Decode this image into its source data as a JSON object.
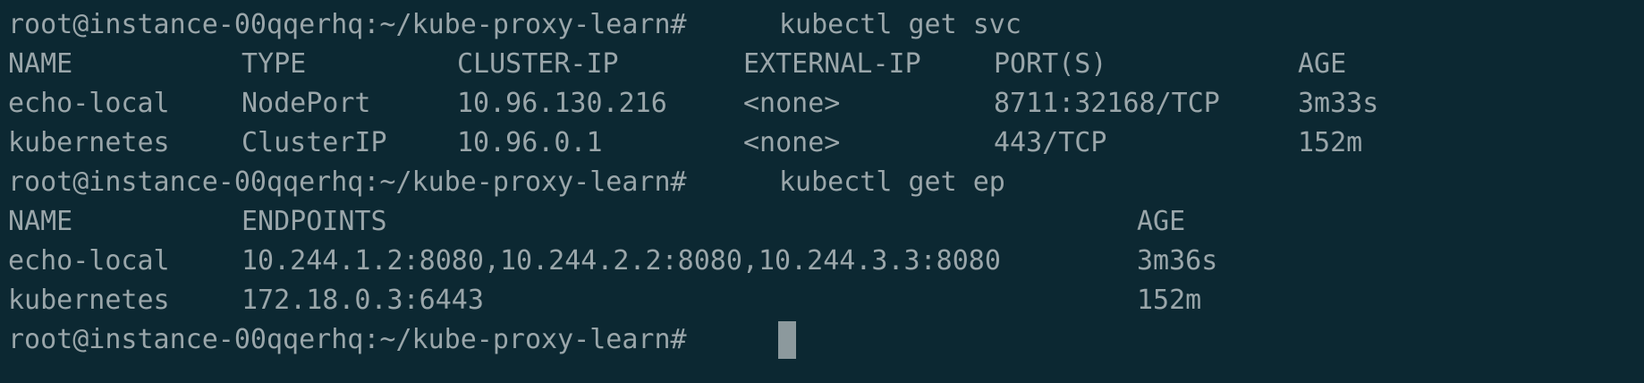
{
  "terminal": {
    "cmd1": {
      "prompt": "root@instance-00qqerhq:~/kube-proxy-learn#",
      "command": "kubectl get svc"
    },
    "svc": {
      "headers": [
        "NAME",
        "TYPE",
        "CLUSTER-IP",
        "EXTERNAL-IP",
        "PORT(S)",
        "AGE"
      ],
      "rows": [
        [
          "echo-local",
          "NodePort",
          "10.96.130.216",
          "<none>",
          "8711:32168/TCP",
          "3m33s"
        ],
        [
          "kubernetes",
          "ClusterIP",
          "10.96.0.1",
          "<none>",
          "443/TCP",
          "152m"
        ]
      ]
    },
    "cmd2": {
      "prompt": "root@instance-00qqerhq:~/kube-proxy-learn#",
      "command": "kubectl get ep"
    },
    "ep": {
      "headers": [
        "NAME",
        "ENDPOINTS",
        "AGE"
      ],
      "rows": [
        [
          "echo-local",
          "10.244.1.2:8080,10.244.2.2:8080,10.244.3.3:8080",
          "3m36s"
        ],
        [
          "kubernetes",
          "172.18.0.3:6443",
          "152m"
        ]
      ]
    },
    "cmd3": {
      "prompt": "root@instance-00qqerhq:~/kube-proxy-learn#",
      "command": ""
    }
  }
}
